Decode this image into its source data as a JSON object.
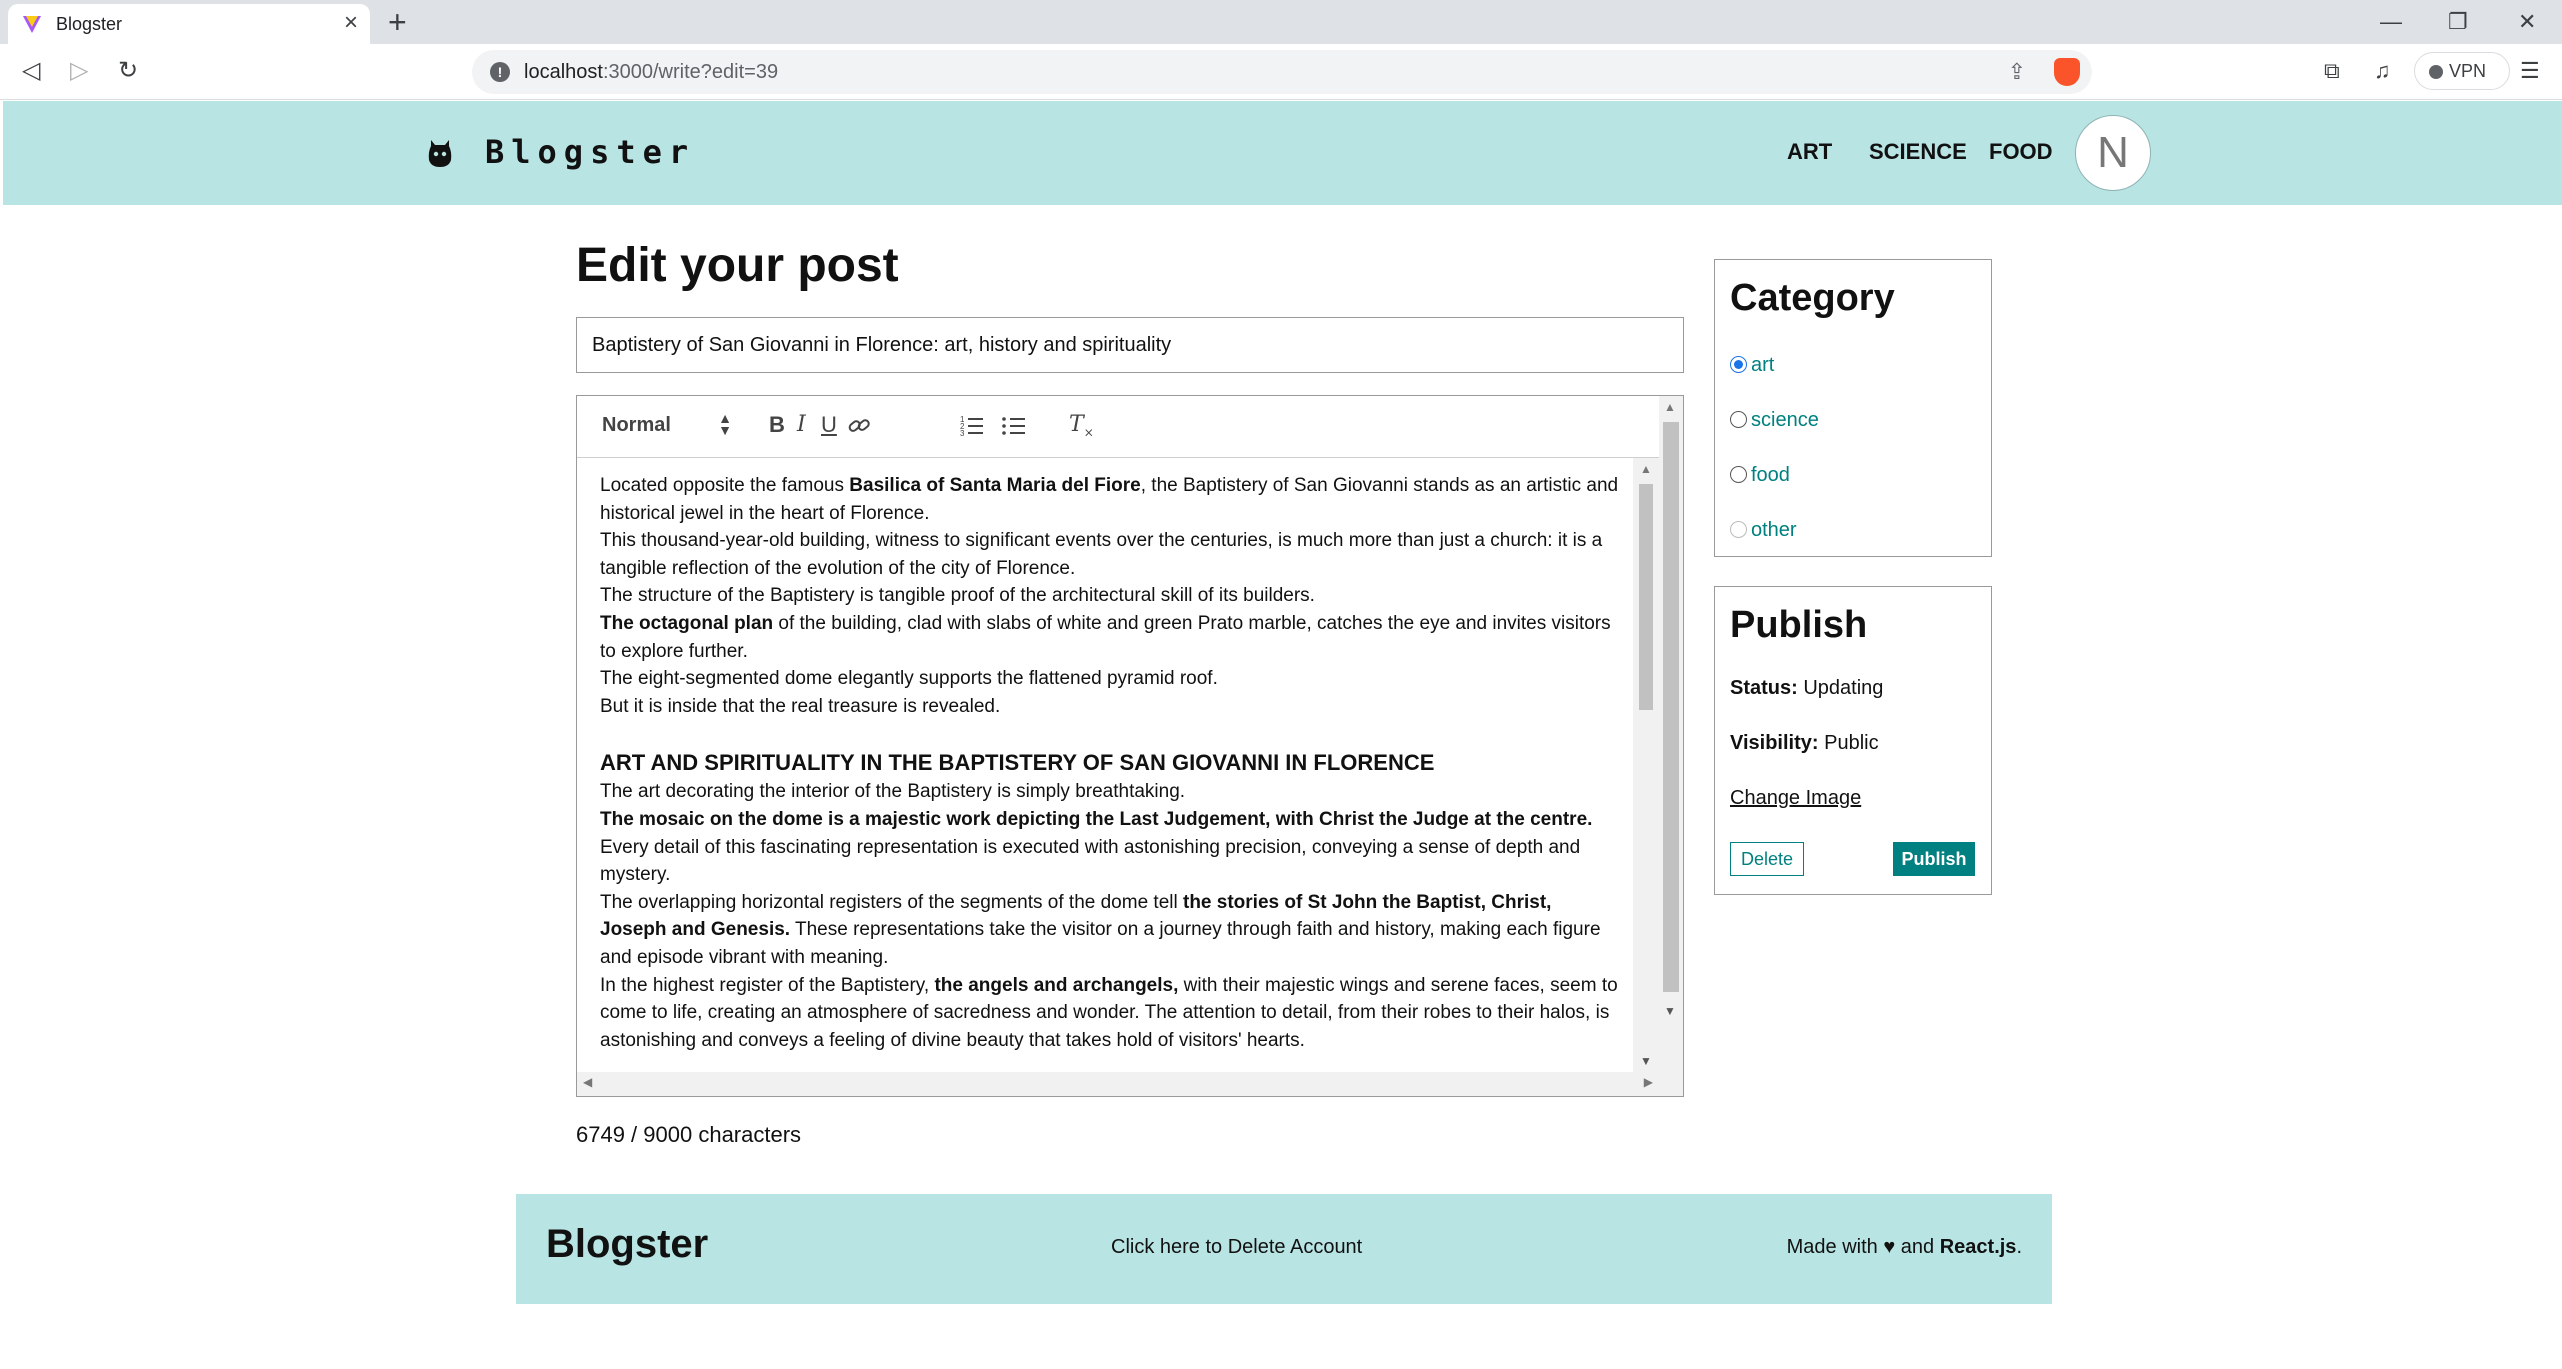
{
  "browser": {
    "tab_title": "Blogster",
    "url_host": "localhost",
    "url_path": ":3000/write?edit=39",
    "vpn_label": "VPN",
    "icons": [
      "back-icon",
      "forward-icon",
      "reload-icon",
      "share-icon",
      "brave-shield-icon",
      "extensions-icon",
      "media-icon",
      "menu-icon"
    ]
  },
  "header": {
    "logo_text": "Blogster",
    "nav": {
      "art": "ART",
      "science": "SCIENCE",
      "food": "FOOD"
    },
    "avatar_letter": "N"
  },
  "editor": {
    "page_title": "Edit your post",
    "title_value": "Baptistery of San Giovanni in Florence: art, history and spirituality",
    "format_select": "Normal",
    "char_count": "6749 / 9000 characters",
    "content": {
      "p1_a": "Located opposite the famous ",
      "p1_b": "Basilica of Santa Maria del Fiore",
      "p1_c": ", the Baptistery of San Giovanni stands as an artistic and historical jewel in the heart of Florence.",
      "p2": "This thousand-year-old building, witness to significant events over the centuries, is much more than just a church: it is a tangible reflection of the evolution of the city of Florence.",
      "p3": "The structure of the Baptistery is tangible proof of the architectural skill of its builders.",
      "p4_a": "The octagonal plan",
      "p4_b": " of the building, clad with slabs of white and green Prato marble, catches the eye and invites visitors to explore further.",
      "p5": "The eight-segmented dome elegantly supports the flattened pyramid roof.",
      "p6": "But it is inside that the real treasure is revealed.",
      "h1": "ART AND SPIRITUALITY IN THE BAPTISTERY OF SAN GIOVANNI IN FLORENCE",
      "p7": "The art decorating the interior of the Baptistery is simply breathtaking.",
      "p8_a": "The mosaic on the dome is a majestic work depicting the Last Judgement, with Christ the Judge at the centre.",
      "p8_b": " Every detail of this fascinating representation is executed with astonishing precision, conveying a sense of depth and mystery.",
      "p9_a": "The overlapping horizontal registers of the segments of the dome tell ",
      "p9_b": "the stories of St John the Baptist, Christ, Joseph and Genesis.",
      "p9_c": " These representations take the visitor on a journey through faith and history, making each figure and episode vibrant with meaning.",
      "p10_a": "In the highest register of the Baptistery, ",
      "p10_b": "the angels and archangels,",
      "p10_c": " with their majestic wings and serene faces, seem to come to life, creating an atmosphere of sacredness and wonder. The attention to detail, from their robes to their halos, is astonishing and conveys a feeling of divine beauty that takes hold of visitors' hearts."
    }
  },
  "category": {
    "heading": "Category",
    "options": [
      {
        "label": "art",
        "checked": true
      },
      {
        "label": "science",
        "checked": false
      },
      {
        "label": "food",
        "checked": false
      },
      {
        "label": "other",
        "checked": false
      }
    ]
  },
  "publish": {
    "heading": "Publish",
    "status_label": "Status:",
    "status_value": "Updating",
    "visibility_label": "Visibility:",
    "visibility_value": "Public",
    "change_image": "Change Image",
    "delete_label": "Delete",
    "publish_label": "Publish"
  },
  "footer": {
    "logo": "Blogster",
    "delete_account": "Click here to Delete Account",
    "made_with_a": "Made with ",
    "heart": "♥",
    "made_with_b": " and ",
    "made_with_c": "React.js",
    "made_with_d": "."
  },
  "colors": {
    "header_bg": "#b9e4e4",
    "accent": "#008080",
    "radio_checked": "#1a73e8"
  }
}
